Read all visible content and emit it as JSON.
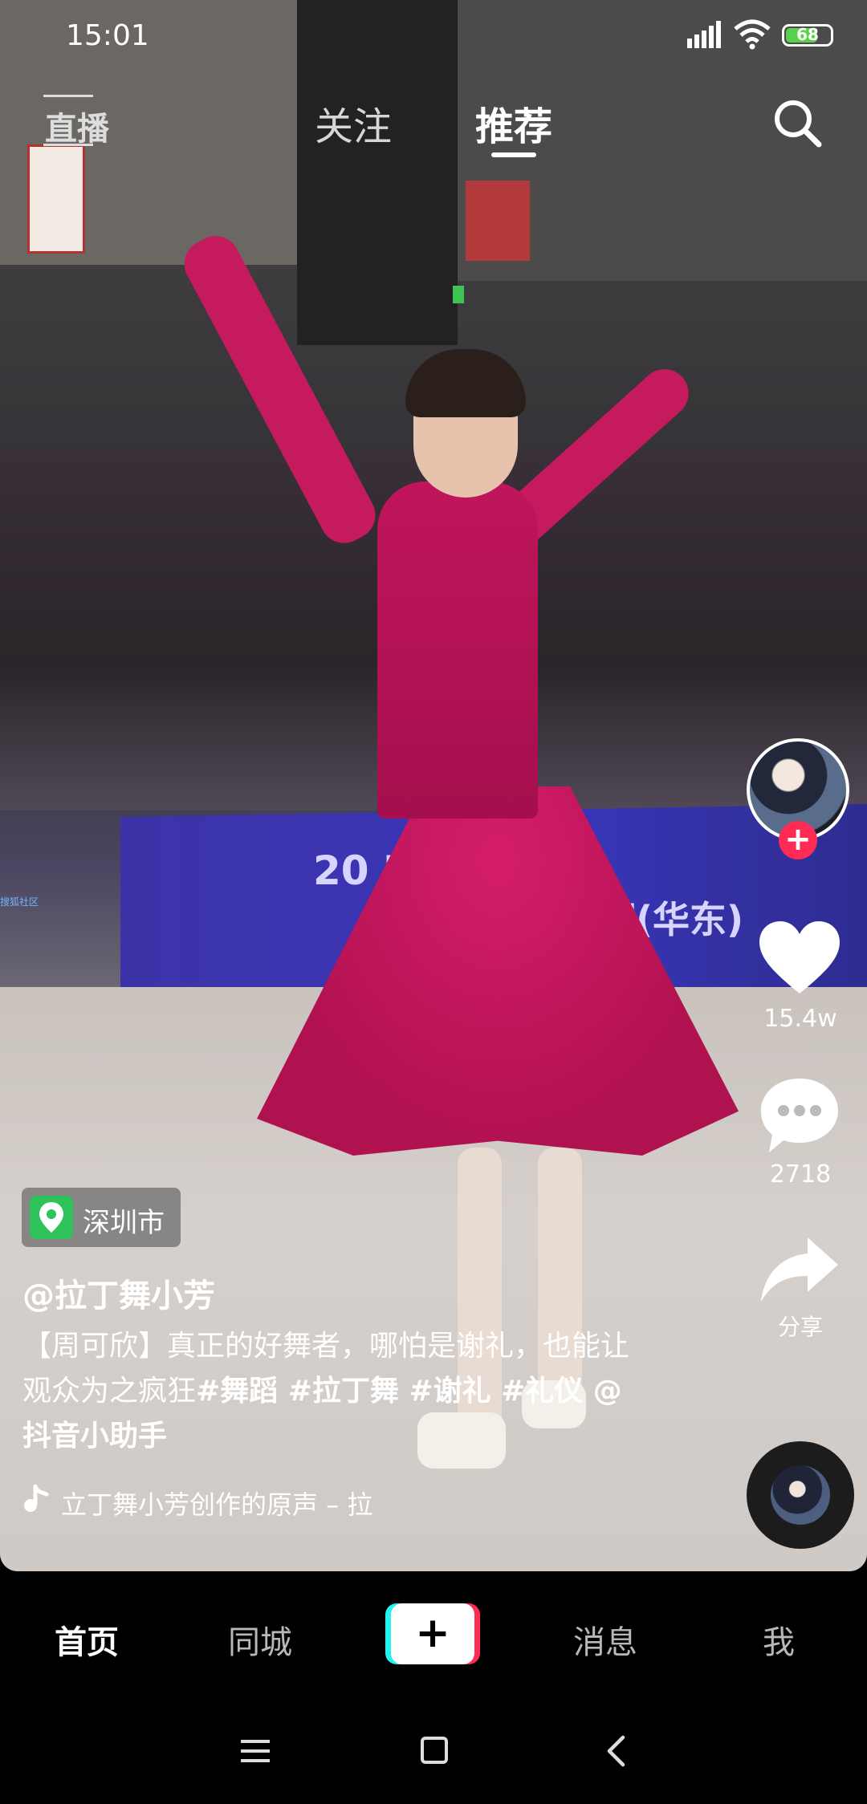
{
  "status_bar": {
    "time": "15:01",
    "battery": "68"
  },
  "top_nav": {
    "live": "直播",
    "tabs": [
      "关注",
      "推荐"
    ],
    "active_tab": "推荐"
  },
  "video_scene": {
    "banner_line1": "20  BDF青少年",
    "banner_line2": "标赛(华东)",
    "side_tag": "搜狐社区"
  },
  "rail": {
    "like_count": "15.4w",
    "comment_count": "2718",
    "share_label": "分享"
  },
  "info": {
    "location": "深圳市",
    "author": "@拉丁舞小芳",
    "desc_plain": "【周可欣】真正的好舞者，哪怕是谢礼，也能让观众为之疯狂",
    "desc_tags": "#舞蹈 #拉丁舞 #谢礼 #礼仪 @抖音小助手",
    "music": "立丁舞小芳创作的原声 – 拉"
  },
  "bottom_tabs": {
    "home": "首页",
    "city": "同城",
    "create": "+",
    "messages": "消息",
    "me": "我"
  },
  "colors": {
    "accent_red": "#fe2c55",
    "accent_cyan": "#25f4ee",
    "location_green": "#2fc25b",
    "battery_green": "#5ad14a"
  },
  "icons": [
    "signal-icon",
    "wifi-icon",
    "battery-icon",
    "live-icon",
    "search-icon",
    "heart-icon",
    "comment-icon",
    "share-icon",
    "music-note-icon",
    "location-pin-icon",
    "menu-icon",
    "home-icon",
    "back-icon"
  ]
}
